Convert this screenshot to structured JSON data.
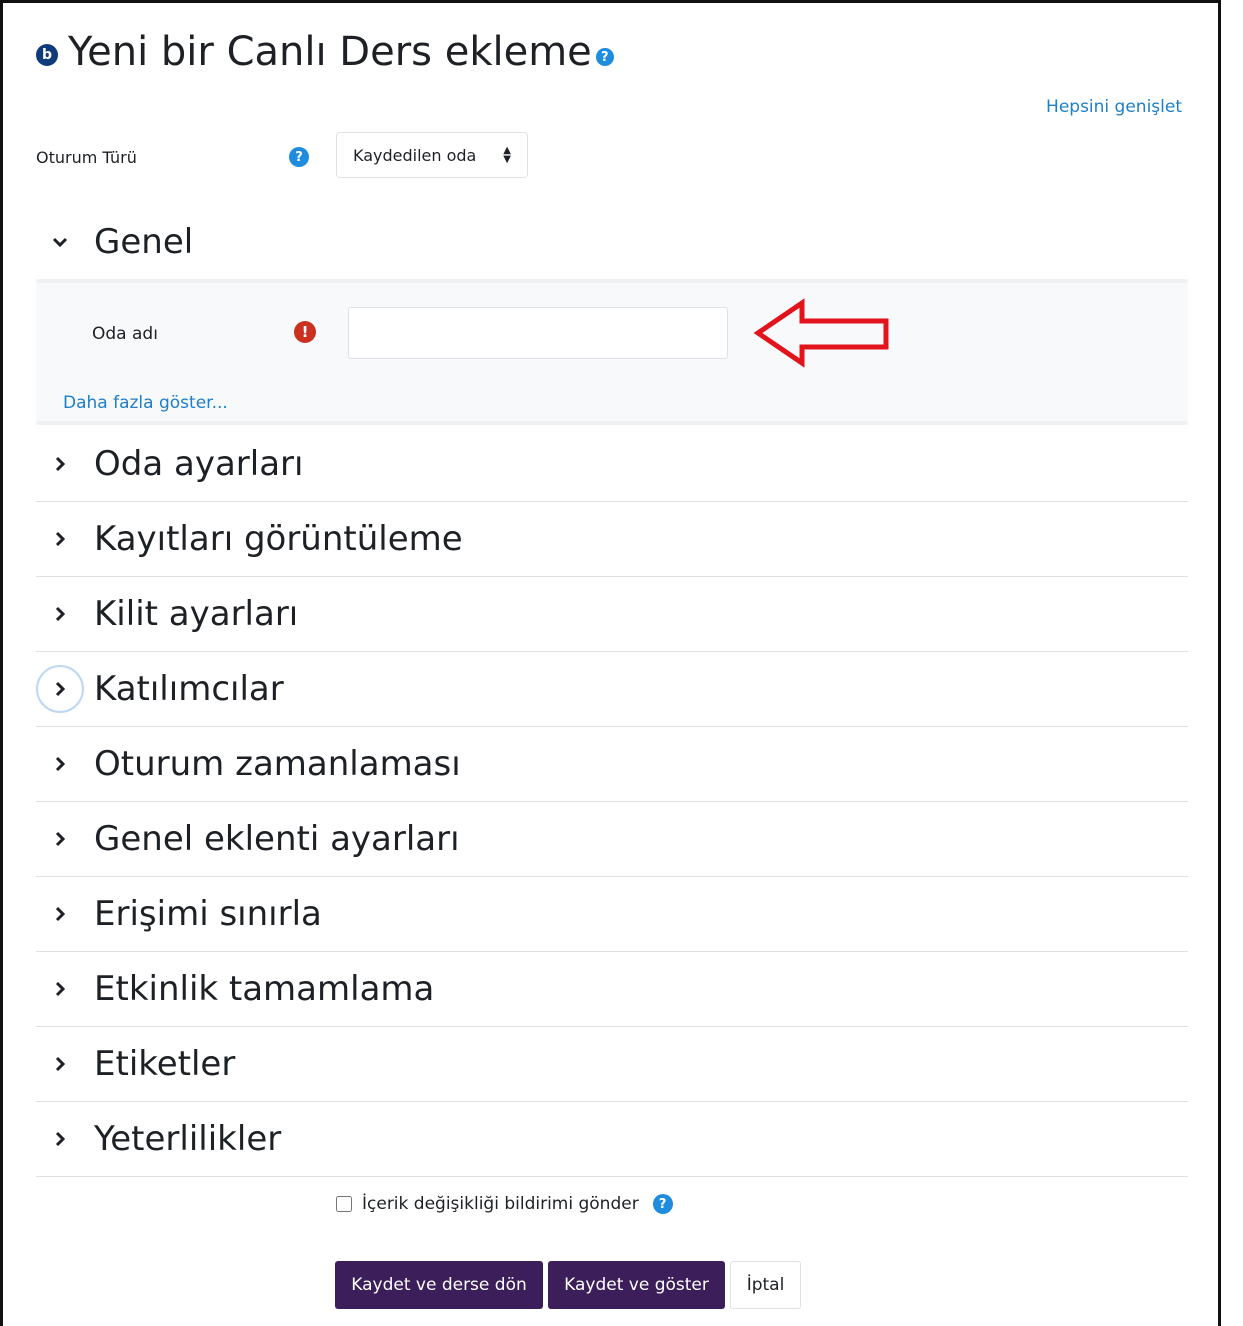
{
  "page": {
    "title_icon": "b",
    "title": "Yeni bir Canlı Ders ekleme",
    "expand_all": "Hepsini genişlet"
  },
  "session_type": {
    "label": "Oturum Türü",
    "selected": "Kaydedilen oda"
  },
  "general": {
    "title": "Genel",
    "room_name_label": "Oda adı",
    "room_name_value": "",
    "show_more": "Daha fazla göster..."
  },
  "sections": [
    {
      "title": "Oda ayarları"
    },
    {
      "title": "Kayıtları görüntüleme"
    },
    {
      "title": "Kilit ayarları"
    },
    {
      "title": "Katılımcılar"
    },
    {
      "title": "Oturum zamanlaması"
    },
    {
      "title": "Genel eklenti ayarları"
    },
    {
      "title": "Erişimi sınırla"
    },
    {
      "title": "Etkinlik tamamlama"
    },
    {
      "title": "Etiketler"
    },
    {
      "title": "Yeterlilikler"
    }
  ],
  "notify": {
    "label": "İçerik değişikliği bildirimi gönder",
    "checked": false
  },
  "buttons": {
    "save_return": "Kaydet ve derse dön",
    "save_display": "Kaydet ve göster",
    "cancel": "İptal"
  },
  "colors": {
    "primary_button": "#3b1e5a",
    "link": "#1f7ec8",
    "help": "#1f8ce0",
    "required": "#ca3120",
    "annotation_arrow": "#e3131b"
  }
}
